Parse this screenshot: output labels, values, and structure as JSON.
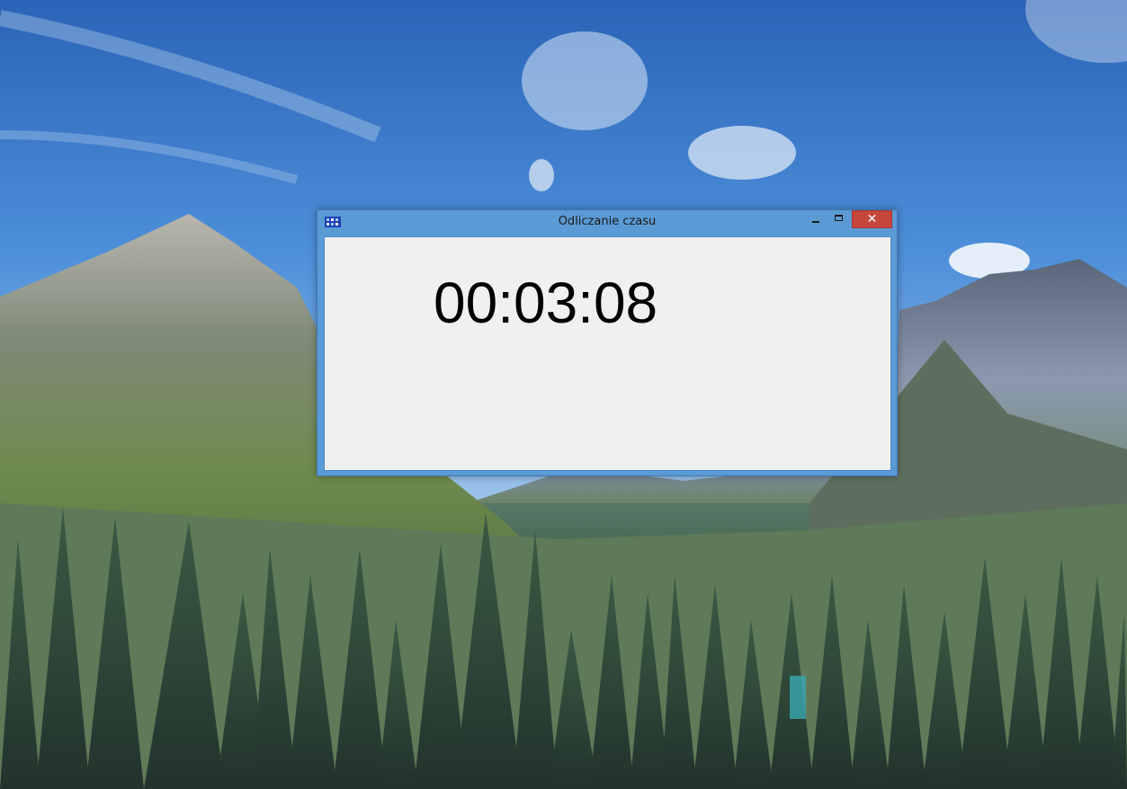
{
  "window": {
    "title": "Odliczanie czasu",
    "icon": "app-grid-icon",
    "controls": {
      "minimize_icon": "minimize-icon",
      "maximize_icon": "maximize-icon",
      "close_icon": "close-icon",
      "close_glyph": "✕"
    },
    "colors": {
      "frame": "#5b9bd5",
      "close": "#c7463b",
      "client": "#f0f0f0"
    }
  },
  "timer": {
    "display": "00:03:08"
  },
  "desktop": {
    "wallpaper": "mountain-forest-landscape"
  }
}
